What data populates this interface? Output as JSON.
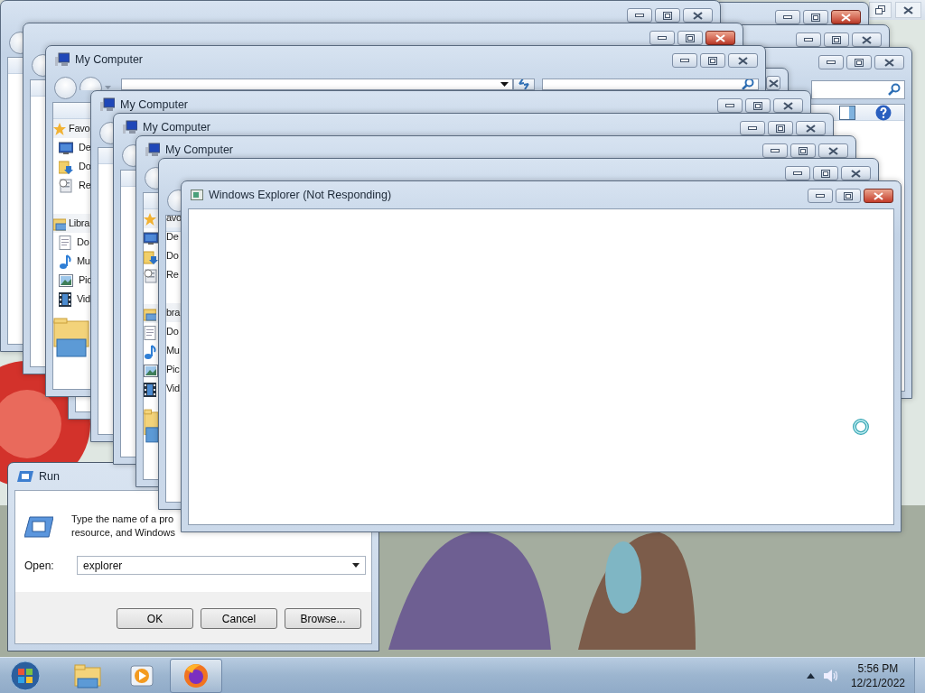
{
  "run_dialog": {
    "title": "Run",
    "description": [
      "Type the name of a pro",
      "resource, and Windows"
    ],
    "open_label": "Open:",
    "open_value": "explorer",
    "buttons": [
      "OK",
      "Cancel",
      "Browse..."
    ]
  },
  "windows": [
    {
      "kind": "maximized"
    },
    {
      "kind": "explorer",
      "close_highlighted": true
    },
    {
      "kind": "explorer",
      "close_highlighted": false
    },
    {
      "kind": "explorer",
      "close_highlighted": false
    },
    {
      "kind": "explorer",
      "close_highlighted": false
    },
    {
      "kind": "explorer",
      "close_highlighted": true
    },
    {
      "kind": "explorer",
      "close_highlighted": false
    },
    {
      "kind": "explorer",
      "title": "My Computer",
      "close_highlighted": false,
      "nav_pane": {
        "kind": "full",
        "items": [
          {
            "kind": "favorites",
            "text": "Favo"
          },
          {
            "kind": "desktop",
            "text": "De"
          },
          {
            "kind": "downloads",
            "text": "Do"
          },
          {
            "kind": "recent",
            "text": "Re"
          },
          {
            "kind": "libraries",
            "text": "Libra"
          },
          {
            "kind": "documents",
            "text": "Do"
          },
          {
            "kind": "music",
            "text": "Mu"
          },
          {
            "kind": "pictures",
            "text": "Pic"
          },
          {
            "kind": "videos",
            "text": "Vid"
          }
        ]
      }
    },
    {
      "kind": "explorer",
      "title": "My Computer",
      "close_highlighted": false
    },
    {
      "kind": "explorer",
      "title": "My Computer",
      "close_highlighted": false
    },
    {
      "kind": "explorer",
      "title": "My Computer",
      "close_highlighted": false,
      "nav_pane": {
        "kind": "icons",
        "items": [
          {
            "kind": "favorites"
          },
          {
            "kind": "desktop"
          },
          {
            "kind": "downloads"
          },
          {
            "kind": "recent"
          },
          {
            "kind": "libraries"
          },
          {
            "kind": "documents"
          },
          {
            "kind": "music"
          },
          {
            "kind": "pictures"
          },
          {
            "kind": "videos"
          }
        ]
      }
    },
    {
      "kind": "explorer",
      "close_highlighted": false,
      "nav_pane": {
        "kind": "labels",
        "items": [
          {
            "kind": "favorites",
            "text": "avo"
          },
          {
            "kind": "desktop",
            "text": "De"
          },
          {
            "kind": "downloads",
            "text": "Do"
          },
          {
            "kind": "recent",
            "text": "Re"
          },
          {
            "kind": "libraries",
            "text": "bra"
          },
          {
            "kind": "documents",
            "text": "Do"
          },
          {
            "kind": "music",
            "text": "Mu"
          },
          {
            "kind": "pictures",
            "text": "Pic"
          },
          {
            "kind": "videos",
            "text": "Vid"
          }
        ]
      }
    },
    {
      "kind": "not_responding",
      "title": "Windows Explorer (Not Responding)",
      "close_highlighted": true
    }
  ],
  "taskbar": {
    "buttons": [
      {
        "kind": "folder",
        "selected": false
      },
      {
        "kind": "player",
        "selected": false
      },
      {
        "kind": "browser",
        "selected": true
      }
    ],
    "clock": {
      "time": "5:56 PM",
      "date": "12/21/2022"
    }
  }
}
